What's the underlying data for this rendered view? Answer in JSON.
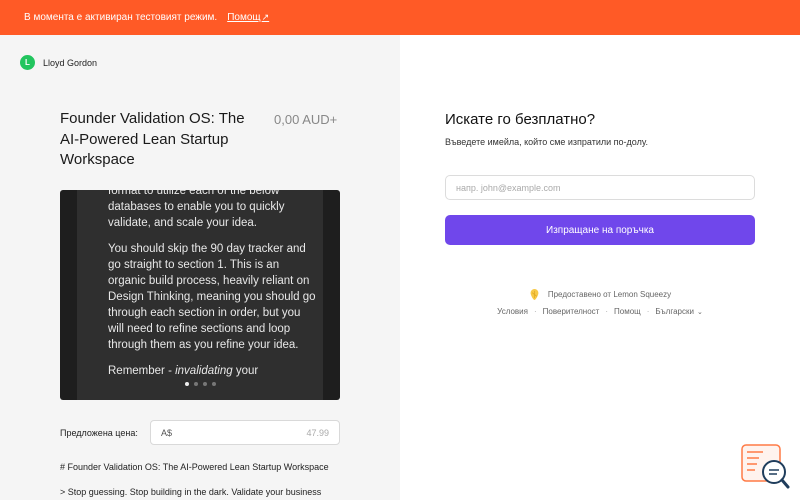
{
  "banner": {
    "text": "В момента е активиран тестовият режим.",
    "help_link": "Помощ",
    "help_icon": "external-link-icon"
  },
  "seller": {
    "avatar_letter": "L",
    "avatar_color": "#22c55e",
    "name": "Lloyd Gordon"
  },
  "product": {
    "title": "Founder Validation OS: The AI-Powered Lean Startup Workspace",
    "price": "0,00 AUD+"
  },
  "media": {
    "paragraphs": [
      "format to utilize each of the below databases to enable you to quickly validate, and scale your idea.",
      "You should skip the 90 day tracker and go straight to section 1. This is an organic build process, heavily reliant on Design Thinking, meaning you should go through each section in order, but you will need to refine sections and loop through them as you refine your idea."
    ],
    "remember_prefix": "Remember - ",
    "remember_emphasis": "invalidating",
    "remember_suffix": " your",
    "slide_count": 4,
    "active_slide": 1
  },
  "pricing": {
    "label": "Предложена цена:",
    "currency": "A$",
    "amount": "47.99"
  },
  "description": {
    "line1": "# Founder Validation OS: The AI-Powered Lean Startup Workspace",
    "line2": "> Stop guessing. Stop building in the dark. Validate your business"
  },
  "form": {
    "title": "Искате го безплатно?",
    "subtitle": "Въведете имейла, който сме изпратили по-долу.",
    "email_placeholder": "напр. john@example.com",
    "submit_label": "Изпращане на поръчка",
    "accent_color": "#7047eb"
  },
  "footer": {
    "powered_by": "Предоставено от Lemon Squeezy",
    "links": {
      "terms": "Условия",
      "privacy": "Поверителност",
      "help": "Помощ",
      "language": "Български"
    }
  },
  "colors": {
    "banner": "#ff5a26",
    "left_panel": "#f5f5f5"
  }
}
